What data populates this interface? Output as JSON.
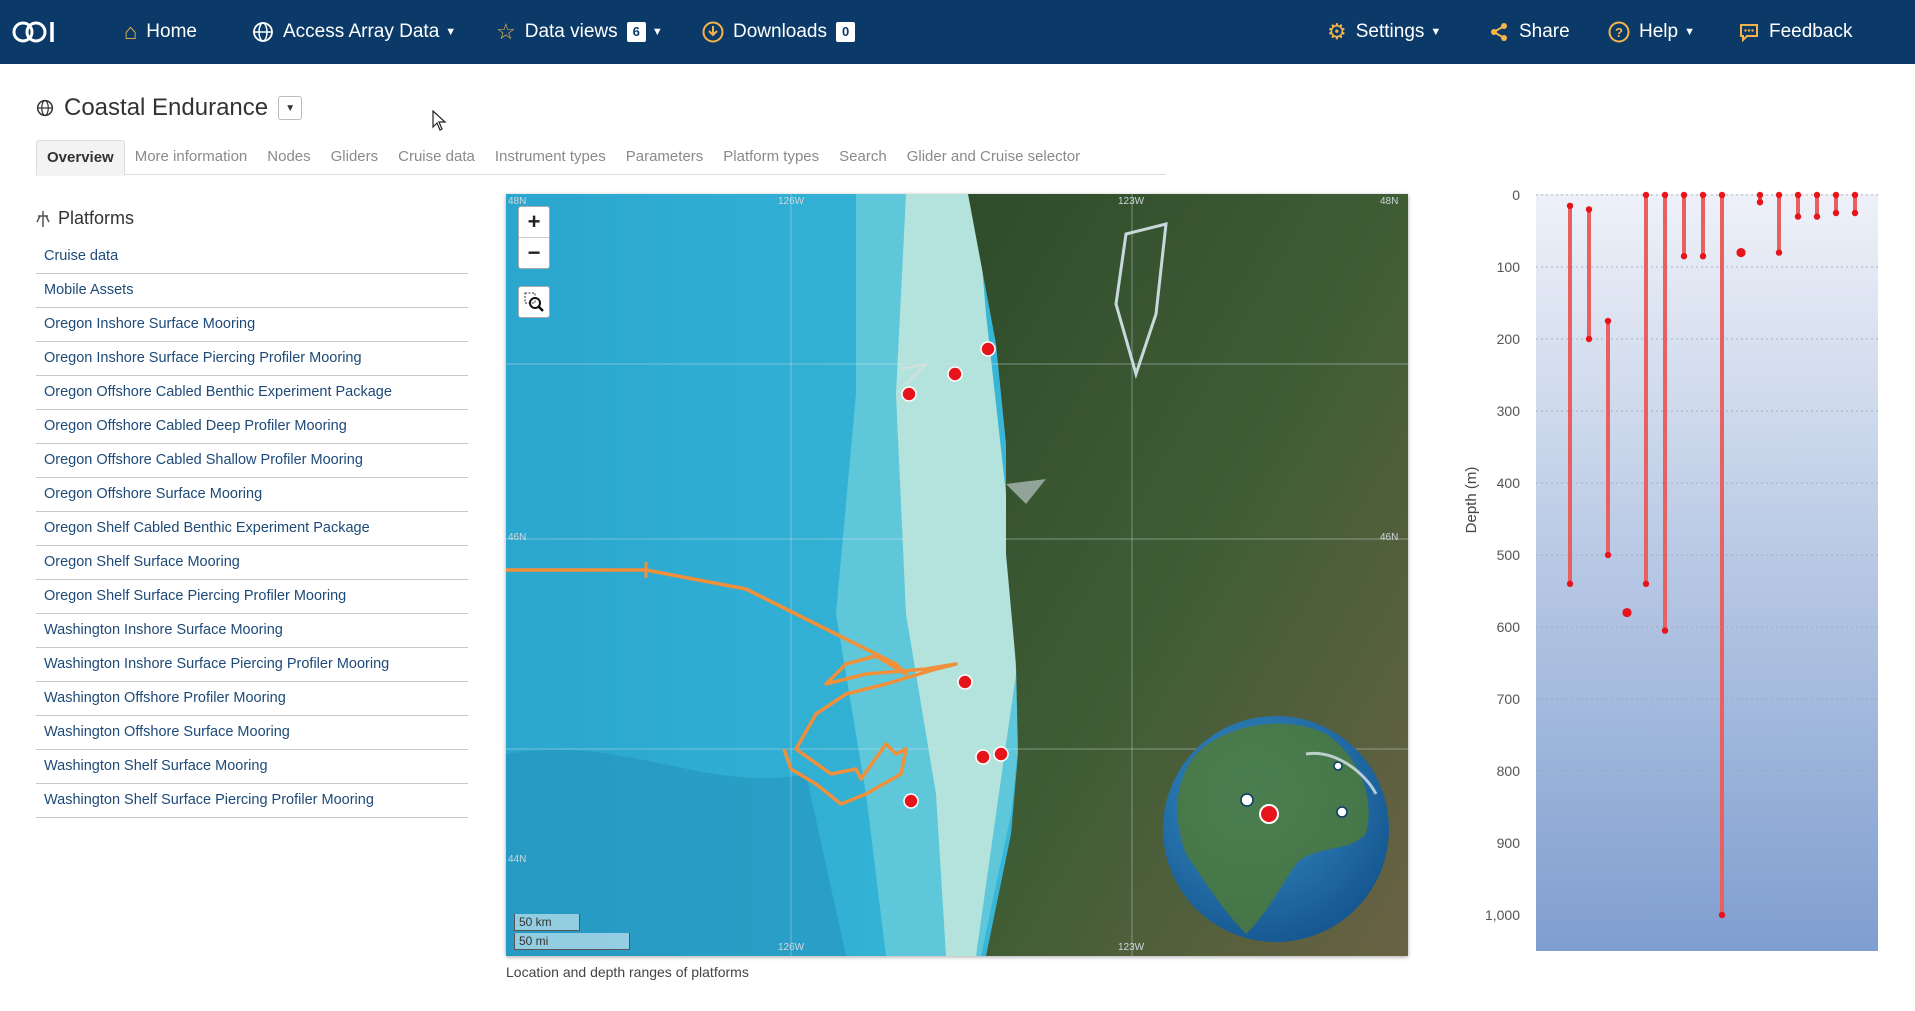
{
  "nav": {
    "home": "Home",
    "access": "Access Array Data",
    "dataviews": "Data views",
    "dataviews_count": "6",
    "downloads": "Downloads",
    "downloads_count": "0",
    "settings": "Settings",
    "share": "Share",
    "help": "Help",
    "feedback": "Feedback"
  },
  "page": {
    "title": "Coastal Endurance"
  },
  "tabs": [
    "Overview",
    "More information",
    "Nodes",
    "Gliders",
    "Cruise data",
    "Instrument types",
    "Parameters",
    "Platform types",
    "Search",
    "Glider and Cruise selector"
  ],
  "sidebar": {
    "heading": "Platforms",
    "items": [
      "Cruise data",
      "Mobile Assets",
      "Oregon Inshore Surface Mooring",
      "Oregon Inshore Surface Piercing Profiler Mooring",
      "Oregon Offshore Cabled Benthic Experiment Package",
      "Oregon Offshore Cabled Deep Profiler Mooring",
      "Oregon Offshore Cabled Shallow Profiler Mooring",
      "Oregon Offshore Surface Mooring",
      "Oregon Shelf Cabled Benthic Experiment Package",
      "Oregon Shelf Surface Mooring",
      "Oregon Shelf Surface Piercing Profiler Mooring",
      "Washington Inshore Surface Mooring",
      "Washington Inshore Surface Piercing Profiler Mooring",
      "Washington Offshore Profiler Mooring",
      "Washington Offshore Surface Mooring",
      "Washington Shelf Surface Mooring",
      "Washington Shelf Surface Piercing Profiler Mooring"
    ]
  },
  "map": {
    "caption": "Location and depth ranges of platforms",
    "scale_km": "50 km",
    "scale_mi": "50 mi",
    "lat_labels": [
      "48N",
      "46N",
      "44N"
    ],
    "lon_labels": [
      "126W",
      "123W"
    ],
    "colors": {
      "ocean": "#2aa3c8",
      "shelf": "#b3e3dc",
      "land": "#3d5a34",
      "track": "#f0903a",
      "marker": "#e8141c"
    }
  },
  "depth_chart": {
    "ylabel": "Depth (m)",
    "ticks": [
      "0",
      "100",
      "200",
      "300",
      "400",
      "500",
      "600",
      "700",
      "800",
      "900",
      "1,000"
    ],
    "ranges": [
      [
        15,
        540
      ],
      [
        20,
        200
      ],
      [
        175,
        500
      ],
      [
        580,
        580
      ],
      [
        0,
        540
      ],
      [
        0,
        605
      ],
      [
        0,
        85
      ],
      [
        0,
        85
      ],
      [
        0,
        1000
      ],
      [
        80,
        80
      ],
      [
        0,
        10
      ],
      [
        0,
        80
      ],
      [
        0,
        30
      ],
      [
        0,
        30
      ],
      [
        0,
        25
      ],
      [
        0,
        25
      ]
    ]
  }
}
